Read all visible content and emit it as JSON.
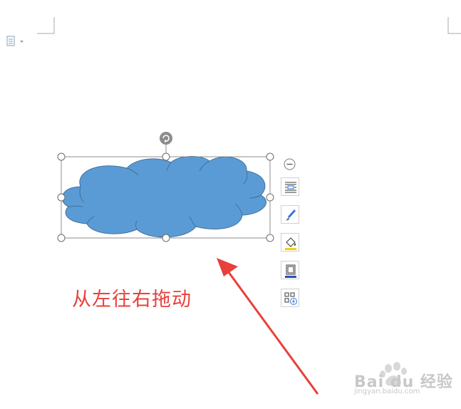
{
  "annotation": {
    "text": "从左往右拖动"
  },
  "shape": {
    "type": "cloud",
    "fill": "#5b9bd5",
    "stroke": "#41719c"
  },
  "side_toolbar": {
    "items": [
      {
        "icon": "collapse-icon"
      },
      {
        "icon": "text-wrap-icon"
      },
      {
        "icon": "shape-style-brush-icon"
      },
      {
        "icon": "fill-bucket-icon"
      },
      {
        "icon": "outline-border-icon"
      },
      {
        "icon": "more-options-icon"
      }
    ]
  },
  "watermark": {
    "brand": "Bai du 经验",
    "url": "jingyan.baidu.com"
  },
  "colors": {
    "arrow": "#e8403a",
    "annotation": "#e8403a",
    "handle_border": "#6b6b6b"
  }
}
